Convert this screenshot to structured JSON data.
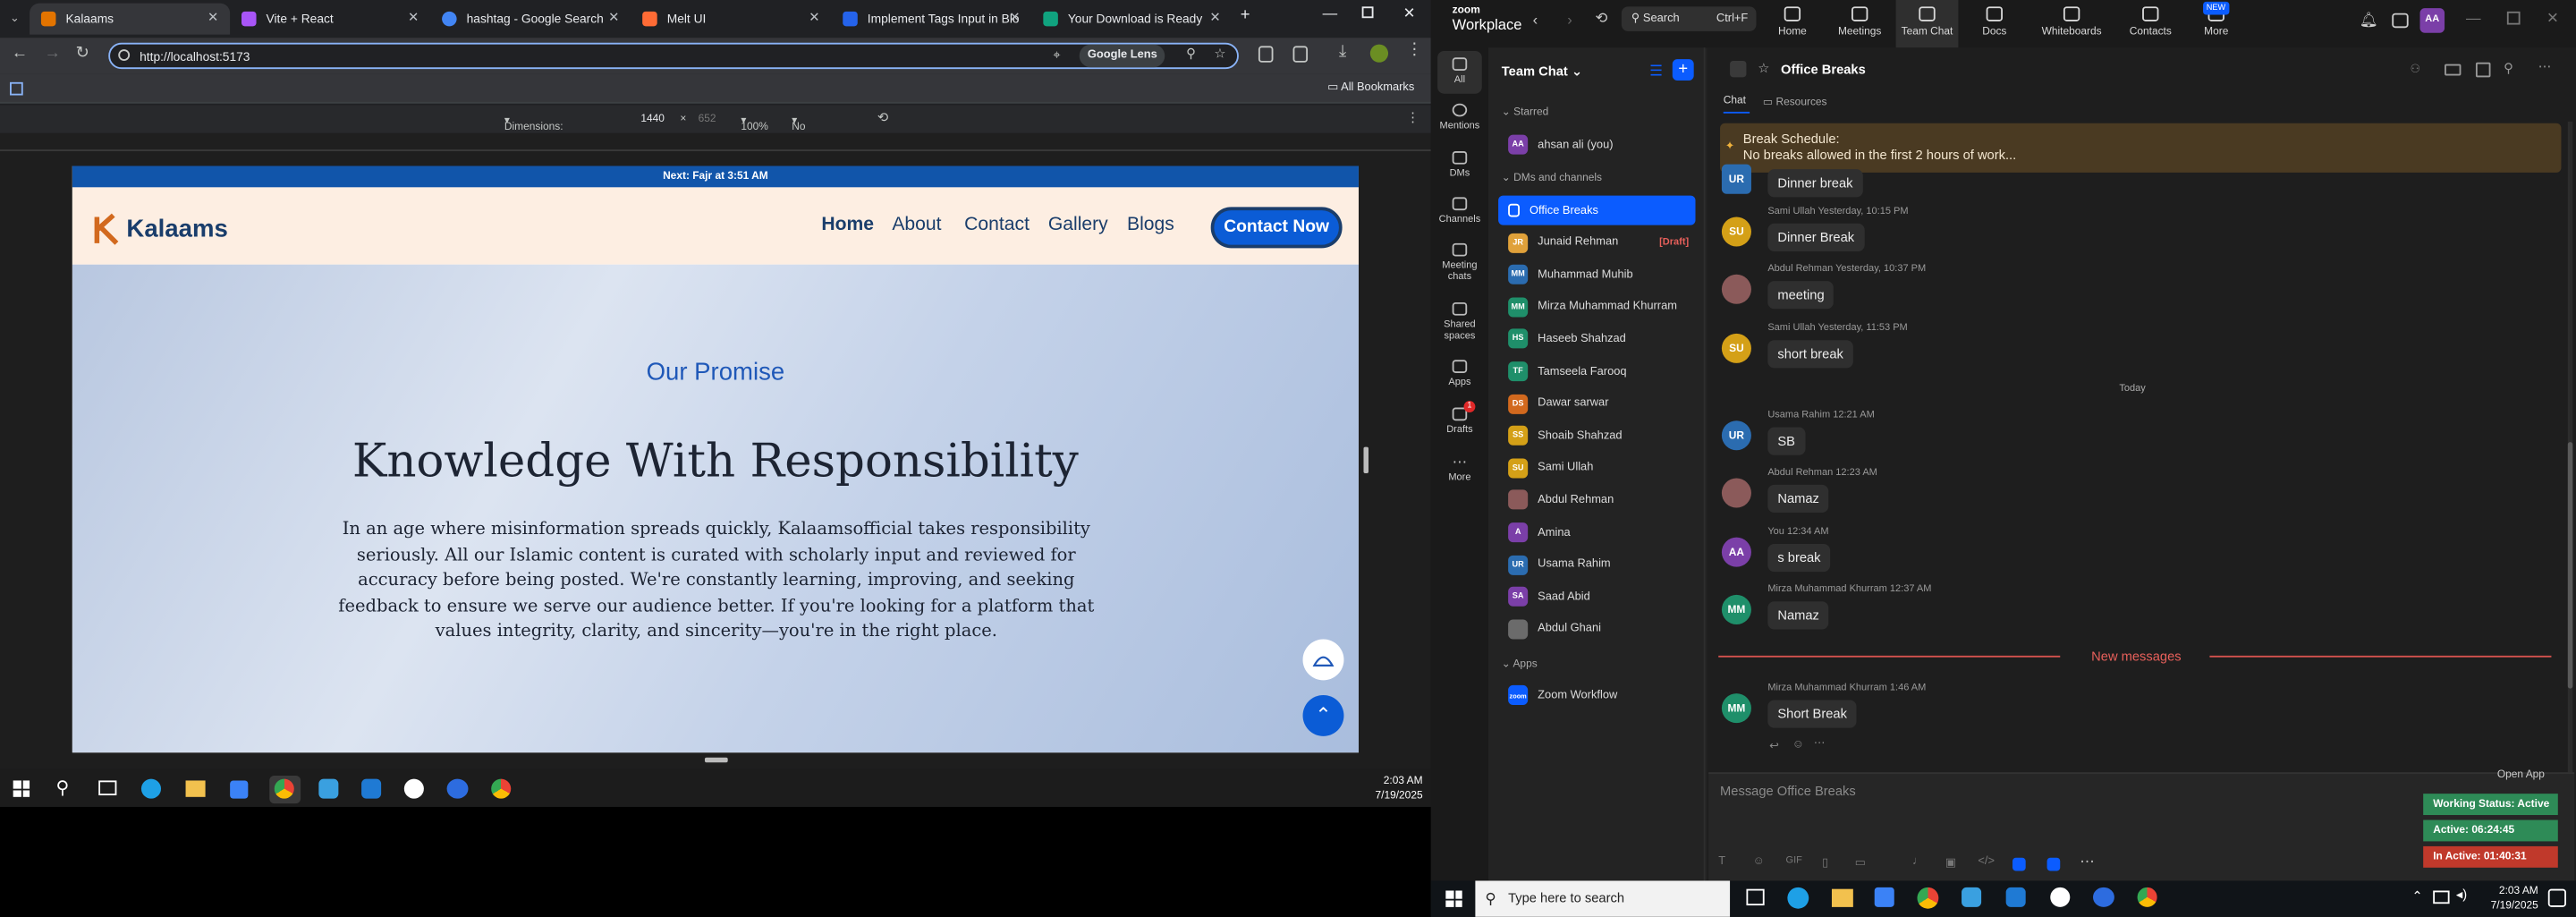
{
  "browser": {
    "tabs": [
      {
        "label": "Kalaams",
        "color": "#e37400",
        "active": true
      },
      {
        "label": "Vite + React",
        "color": "#a855f7",
        "active": false
      },
      {
        "label": "hashtag - Google Search",
        "color": "#4285f4",
        "active": false
      },
      {
        "label": "Melt UI",
        "color": "#ff6b35",
        "active": false
      },
      {
        "label": "Implement Tags Input in Blo",
        "color": "#2563eb",
        "active": false
      },
      {
        "label": "Your Download is Ready",
        "color": "#10a37f",
        "active": false
      }
    ],
    "url": "http://localhost:5173",
    "lens_label": "Google Lens",
    "bookmarks_label": "All Bookmarks",
    "devtools": {
      "dimensions_label": "Dimensions: Responsive",
      "width": "1440",
      "times": "×",
      "height": "652",
      "zoom": "100%",
      "throttle": "No throttling"
    }
  },
  "website": {
    "announcement": "Next: Fajr at 3:51 AM",
    "logo_text": "Kalaams",
    "nav": [
      "Home",
      "About",
      "Contact",
      "Gallery",
      "Blogs"
    ],
    "cta": "Contact Now",
    "kicker": "Our Promise",
    "heading": "Knowledge With Responsibility",
    "body": "In an age where misinformation spreads quickly, Kalaamsofficial takes responsibility seriously. All our Islamic content is curated with scholarly input and reviewed for accuracy before being posted. We're constantly learning, improving, and seeking feedback to ensure we serve our audience better. If you're looking for a platform that values integrity, clarity, and sincerity—you're in the right place."
  },
  "taskbar_left": {
    "time": "2:03 AM",
    "date": "7/19/2025"
  },
  "zoom": {
    "brand_top": "zoom",
    "brand": "Workplace",
    "search_label": "Search",
    "search_shortcut": "Ctrl+F",
    "nav": [
      {
        "label": "Home",
        "active": false
      },
      {
        "label": "Meetings",
        "active": false
      },
      {
        "label": "Team Chat",
        "active": true
      },
      {
        "label": "Docs",
        "active": false
      },
      {
        "label": "Whiteboards",
        "active": false
      },
      {
        "label": "Contacts",
        "active": false
      },
      {
        "label": "More",
        "active": false
      }
    ],
    "new_badge": "NEW",
    "user_initials": "AA",
    "rail": [
      "All",
      "Mentions",
      "DMs",
      "Channels",
      "Meeting chats",
      "Shared spaces",
      "Apps",
      "Drafts",
      "More"
    ],
    "drafts_count": "1",
    "team_chat_title": "Team Chat",
    "starred_label": "Starred",
    "starred": [
      {
        "name": "ahsan ali (you)",
        "initials": "AA",
        "color": "#7b3fa8"
      }
    ],
    "dms_label": "DMs and channels",
    "channels": [
      {
        "name": "Office Breaks",
        "initials": "",
        "color": "#0b5cff",
        "active": true,
        "draft": ""
      },
      {
        "name": "Junaid Rehman",
        "initials": "JR",
        "color": "#e0a13a",
        "active": false,
        "draft": "[Draft]"
      },
      {
        "name": "Muhammad Muhib",
        "initials": "MM",
        "color": "#2b6cb0",
        "active": false,
        "draft": ""
      },
      {
        "name": "Mirza Muhammad Khurram",
        "initials": "MM",
        "color": "#1f8f6a",
        "active": false,
        "draft": ""
      },
      {
        "name": "Haseeb Shahzad",
        "initials": "HS",
        "color": "#1f8f6a",
        "active": false,
        "draft": ""
      },
      {
        "name": "Tamseela Farooq",
        "initials": "TF",
        "color": "#1f8f6a",
        "active": false,
        "draft": ""
      },
      {
        "name": "Dawar sarwar",
        "initials": "DS",
        "color": "#d2691e",
        "active": false,
        "draft": ""
      },
      {
        "name": "Shoaib Shahzad",
        "initials": "SS",
        "color": "#d4a017",
        "active": false,
        "draft": ""
      },
      {
        "name": "Sami Ullah",
        "initials": "SU",
        "color": "#d4a017",
        "active": false,
        "draft": ""
      },
      {
        "name": "Abdul Rehman",
        "initials": "",
        "color": "#8b5a5a",
        "active": false,
        "draft": ""
      },
      {
        "name": "Amina",
        "initials": "A",
        "color": "#7b3fa8",
        "active": false,
        "draft": ""
      },
      {
        "name": "Usama Rahim",
        "initials": "UR",
        "color": "#2b6cb0",
        "active": false,
        "draft": ""
      },
      {
        "name": "Saad Abid",
        "initials": "SA",
        "color": "#7b3fa8",
        "active": false,
        "draft": ""
      },
      {
        "name": "Abdul Ghani",
        "initials": "",
        "color": "#6b6b6b",
        "active": false,
        "draft": ""
      }
    ],
    "apps_label": "Apps",
    "apps": [
      {
        "name": "Zoom Workflow",
        "initials": "zoom",
        "color": "#0b5cff"
      }
    ],
    "channel_title": "Office Breaks",
    "tab_chat": "Chat",
    "tab_resources": "Resources",
    "pinned_title": "Break Schedule:",
    "pinned_body": "No breaks allowed in the first 2 hours of work...",
    "messages": [
      {
        "initials": "UR",
        "color": "#2b6cb0",
        "meta": "",
        "text": "Dinner break"
      },
      {
        "initials": "SU",
        "color": "#d4a017",
        "meta": "Sami Ullah Yesterday, 10:15 PM",
        "text": "Dinner Break"
      },
      {
        "initials": "",
        "color": "#8b5a5a",
        "meta": "Abdul Rehman Yesterday, 10:37 PM",
        "text": "meeting"
      },
      {
        "initials": "SU",
        "color": "#d4a017",
        "meta": "Sami Ullah Yesterday, 11:53 PM",
        "text": "short break"
      },
      {
        "initials": "UR",
        "color": "#2b6cb0",
        "meta": "Usama Rahim 12:21 AM",
        "text": "SB"
      },
      {
        "initials": "",
        "color": "#8b5a5a",
        "meta": "Abdul Rehman 12:23 AM",
        "text": "Namaz"
      },
      {
        "initials": "AA",
        "color": "#7b3fa8",
        "meta": "You 12:34 AM",
        "text": "s break"
      },
      {
        "initials": "MM",
        "color": "#1f8f6a",
        "meta": "Mirza Muhammad Khurram 12:37 AM",
        "text": "Namaz"
      },
      {
        "initials": "MM",
        "color": "#1f8f6a",
        "meta": "Mirza Muhammad Khurram 1:46 AM",
        "text": "Short Break"
      }
    ],
    "day_divider": "Today",
    "new_messages": "New messages",
    "composer_placeholder": "Message Office Breaks",
    "open_app": "Open App",
    "status": [
      {
        "text": "Working Status: Active",
        "color": "#2e8b57"
      },
      {
        "text": "Active: 06:24:45",
        "color": "#2e8b57"
      },
      {
        "text": "In Active: 01:40:31",
        "color": "#c0392b"
      }
    ]
  },
  "taskbar_right": {
    "search_placeholder": "Type here to search",
    "time": "2:03 AM",
    "date": "7/19/2025"
  }
}
